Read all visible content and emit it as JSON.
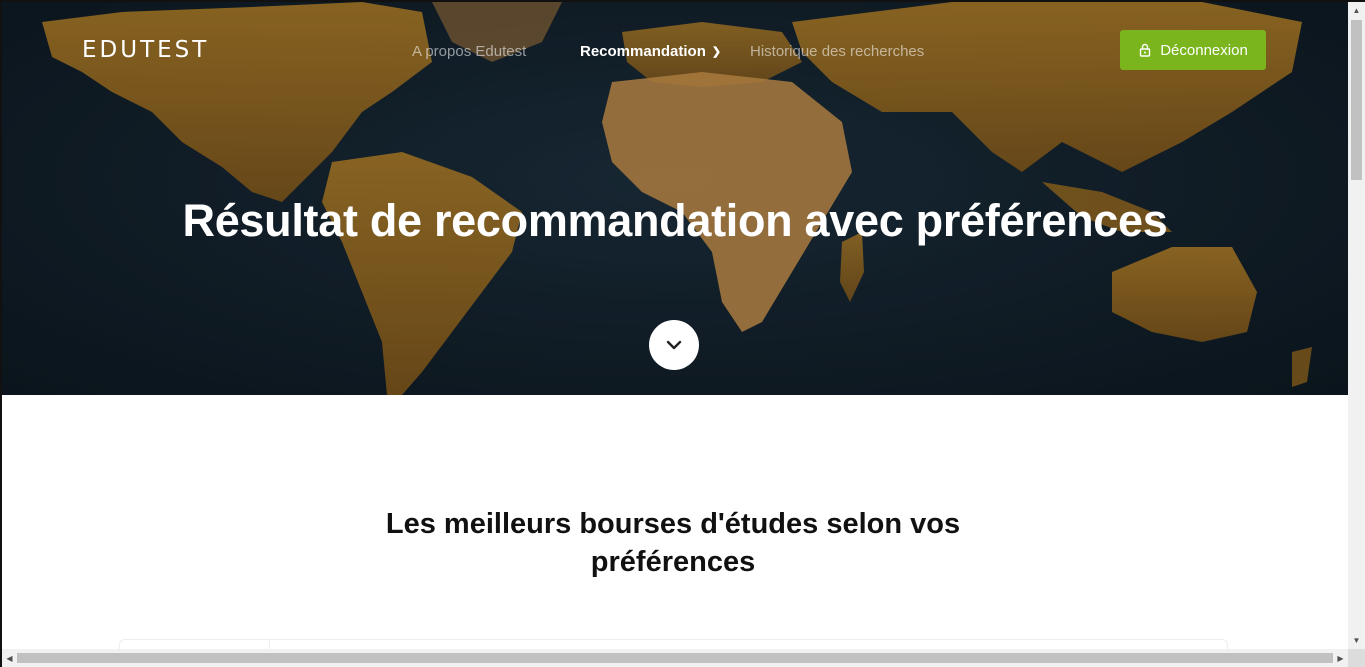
{
  "header": {
    "brand": "EDUTEST",
    "nav": [
      {
        "label": "A propos Edutest"
      },
      {
        "label": "Recommandation"
      },
      {
        "label": "Historique des recherches"
      }
    ],
    "logout_label": "Déconnexion"
  },
  "hero": {
    "title": "Résultat de recommandation avec préférences"
  },
  "main": {
    "section_title_line1": "Les meilleurs bourses d'études selon vos",
    "section_title_line2": "préférences"
  },
  "colors": {
    "accent": "#7ab51d",
    "hero_bg": "#13212c",
    "land": "#a8741e"
  },
  "icons": [
    "lock-icon",
    "chevron-down-icon",
    "scroll-down-icon"
  ]
}
